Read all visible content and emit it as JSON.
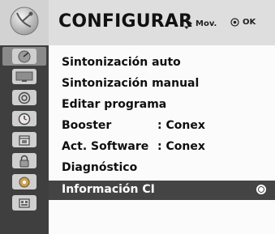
{
  "header": {
    "title": "CONFIGURAR",
    "hint_move": "Mov.",
    "hint_ok": "OK",
    "logo_icon": "satellite-dish-icon"
  },
  "sidebar": {
    "items": [
      {
        "icon": "satellite-dish-icon",
        "active": true
      },
      {
        "icon": "tv-screen-icon",
        "active": false
      },
      {
        "icon": "speaker-icon",
        "active": false
      },
      {
        "icon": "clock-icon",
        "active": false
      },
      {
        "icon": "calendar-icon",
        "active": false
      },
      {
        "icon": "lock-icon",
        "active": false
      },
      {
        "icon": "option-gear-icon",
        "active": false
      },
      {
        "icon": "media-link-icon",
        "active": false
      }
    ]
  },
  "menu": {
    "items": [
      {
        "label": "Sintonización auto",
        "value": ""
      },
      {
        "label": "Sintonización manual",
        "value": ""
      },
      {
        "label": "Editar programa",
        "value": ""
      },
      {
        "label": "Booster",
        "value": ": Conex"
      },
      {
        "label": "Act. Software",
        "value": ": Conex"
      },
      {
        "label": "Diagnóstico",
        "value": ""
      },
      {
        "label": "Información CI",
        "value": "",
        "selected": true
      }
    ]
  },
  "colors": {
    "header_bg": "#dedede",
    "sidebar_bg": "#3f3f3f",
    "selected_bg": "#444444",
    "panel_bg": "#fbfbfb"
  }
}
